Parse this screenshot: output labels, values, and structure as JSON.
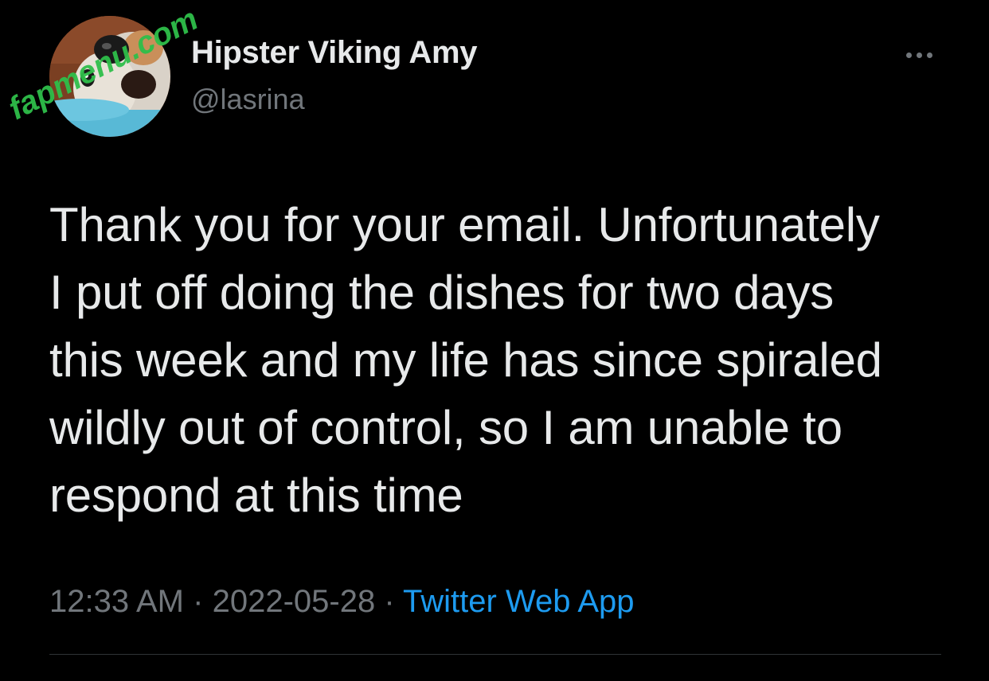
{
  "tweet": {
    "author": {
      "display_name": "Hipster Viking Amy",
      "handle": "@lasrina",
      "avatar_description": "dog-photo"
    },
    "more_icon": "more-horizontal-icon",
    "text_lines": [
      "Thank you for your email. Unfortunately",
      "I put off doing the dishes for two days",
      "this week and my life has since spiraled",
      "wildly out of control, so I am unable to",
      "respond at this time"
    ],
    "time": "12:33 AM",
    "separator": "·",
    "date": "2022-05-28",
    "source": "Twitter Web App"
  },
  "watermark": {
    "text": "fapmenu.com",
    "color": "#2fbf4a"
  },
  "colors": {
    "background": "#000000",
    "primary_text": "#e7e9ea",
    "secondary_text": "#71767b",
    "link": "#1d9bf0",
    "divider": "#2f3336"
  }
}
